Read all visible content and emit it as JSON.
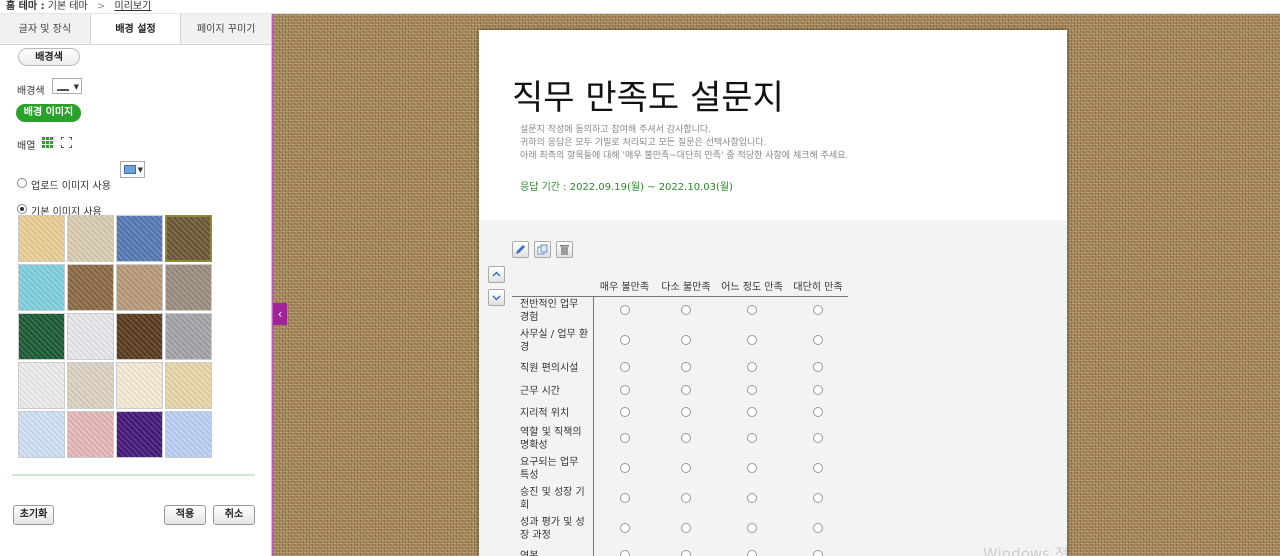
{
  "breadcrumb": {
    "prefix": "홈 테마 :",
    "theme": "기본 테마",
    "sep": ">",
    "current": "미리보기"
  },
  "tabs": [
    {
      "label": "글자 및 장식",
      "active": false
    },
    {
      "label": "배경 설정",
      "active": true
    },
    {
      "label": "페이지 꾸미기",
      "active": false
    }
  ],
  "bg_color": {
    "header": "배경색",
    "label": "배경색"
  },
  "bg_image": {
    "header": "배경 이미지",
    "layout_label": "배열",
    "upload_label": "업로드 이미지 사용",
    "default_label": "기본 이미지 사용",
    "selected_option": "default"
  },
  "tile_icons": [
    "tan-texture",
    "linen-texture",
    "blue-denim",
    "burlap",
    "water-ripple",
    "crumpled-paper",
    "fossil",
    "gravel",
    "green-marble",
    "white-marble",
    "brown-wood",
    "granite",
    "white-stucco",
    "beige-fabric",
    "cream-paper",
    "parchment",
    "light-blue-paper",
    "pink-paper",
    "purple-velvet",
    "light-blue-cloud"
  ],
  "tile_colors": [
    "#e9cf96",
    "#d9ccb0",
    "#5479b8",
    "#6b5836",
    "#7fcfe0",
    "#8b6a44",
    "#b89a77",
    "#9b8d80",
    "#1c5a35",
    "#e8e8ec",
    "#5a3a1e",
    "#a4a4a8",
    "#ececec",
    "#dcd2c2",
    "#f6ead2",
    "#ead6a8",
    "#cfe1f6",
    "#e6b7b7",
    "#45187a",
    "#b9cff4"
  ],
  "buttons": {
    "reset": "초기화",
    "apply": "적용",
    "cancel": "취소"
  },
  "survey": {
    "title": "직무 만족도 설문지",
    "intro": [
      "설문지 작성에 동의하고 참여해 주셔서 감사합니다.",
      "귀하의 응답은 모두 기밀로 처리되고 모든 질문은 선택사항입니다.",
      "아래 최측의 항목들에 대해 '매우 불만족~대단히 만족' 중 적당한 사항에 체크해 주세요."
    ],
    "period": "응답 기간 : 2022.09.19(월) ~ 2022.10.03(월)",
    "columns": [
      "매우 불만족",
      "다소 불만족",
      "어느 정도 만족",
      "대단히 만족"
    ],
    "rows": [
      "전반적인 업무 경험",
      "사무실 / 업무 환경",
      "직원 편의시설",
      "근무 시간",
      "지리적 위치",
      "역할 및 직책의 명확성",
      "요구되는 업무 특성",
      "승진 및 성장 기회",
      "성과 평가 및 성장 과정",
      "연봉"
    ]
  },
  "watermark": "Windows 정",
  "colors": {
    "accent_green": "#2aa12a",
    "collapse_tab": "#a0239a",
    "period_text": "#2a8a2a"
  }
}
